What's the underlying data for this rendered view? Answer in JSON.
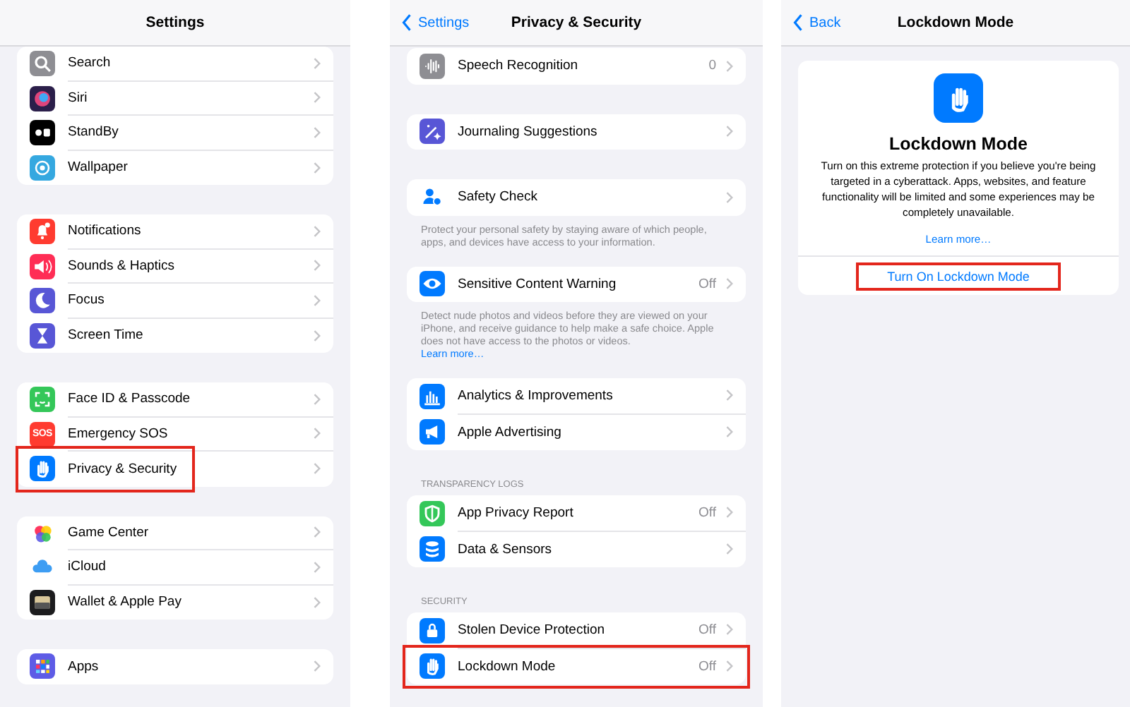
{
  "screens": [
    {
      "kind": "list",
      "title": "Settings",
      "groups": [
        {
          "items": [
            {
              "label": "Search",
              "color": "#8e8e93",
              "highlighted": false
            },
            {
              "label": "Siri",
              "color": "#2b1f4a",
              "highlighted": false
            },
            {
              "label": "StandBy",
              "color": "#000000",
              "highlighted": false
            },
            {
              "label": "Wallpaper",
              "color": "#35a8e0",
              "highlighted": false
            }
          ]
        },
        {
          "items": [
            {
              "label": "Notifications",
              "color": "#ff3b30",
              "highlighted": false
            },
            {
              "label": "Sounds & Haptics",
              "color": "#ff2d55",
              "highlighted": false
            },
            {
              "label": "Focus",
              "color": "#5856d6",
              "highlighted": false
            },
            {
              "label": "Screen Time",
              "color": "#5856d6",
              "highlighted": false
            }
          ]
        },
        {
          "items": [
            {
              "label": "Face ID & Passcode",
              "color": "#34c759",
              "highlighted": false
            },
            {
              "label": "Emergency SOS",
              "color": "#ff3b30",
              "icon_text": "SOS",
              "highlighted": false
            },
            {
              "label": "Privacy & Security",
              "color": "#007aff",
              "highlighted": true
            }
          ]
        },
        {
          "items": [
            {
              "label": "Game Center",
              "color": "#ffffff",
              "highlighted": false
            },
            {
              "label": "iCloud",
              "color": "#ffffff",
              "highlighted": false
            },
            {
              "label": "Wallet & Apple Pay",
              "color": "#1c1c1e",
              "highlighted": false
            }
          ]
        },
        {
          "items": [
            {
              "label": "Apps",
              "color": "#5e5ce6",
              "highlighted": false
            }
          ]
        }
      ]
    },
    {
      "kind": "list",
      "back": "Settings",
      "title": "Privacy & Security",
      "groups": [
        {
          "items": [
            {
              "label": "Speech Recognition",
              "value": "0",
              "color": "#8e8e93",
              "highlighted": false
            }
          ]
        },
        {
          "items": [
            {
              "label": "Journaling Suggestions",
              "color": "#5856d6",
              "highlighted": false
            }
          ]
        },
        {
          "items": [
            {
              "label": "Safety Check",
              "color": "#ffffff",
              "highlighted": false
            }
          ],
          "footer": "Protect your personal safety by staying aware of which people, apps, and devices have access to your information."
        },
        {
          "items": [
            {
              "label": "Sensitive Content Warning",
              "value": "Off",
              "color": "#007aff",
              "highlighted": false
            }
          ],
          "footer": "Detect nude photos and videos before they are viewed on your iPhone, and receive guidance to help make a safe choice. Apple does not have access to the photos or videos.",
          "footer_link": "Learn more…"
        },
        {
          "items": [
            {
              "label": "Analytics & Improvements",
              "color": "#007aff",
              "highlighted": false
            },
            {
              "label": "Apple Advertising",
              "color": "#007aff",
              "highlighted": false
            }
          ]
        },
        {
          "header": "TRANSPARENCY LOGS",
          "items": [
            {
              "label": "App Privacy Report",
              "value": "Off",
              "color": "#34c759",
              "highlighted": false
            },
            {
              "label": "Data & Sensors",
              "color": "#007aff",
              "highlighted": false
            }
          ]
        },
        {
          "header": "SECURITY",
          "items": [
            {
              "label": "Stolen Device Protection",
              "value": "Off",
              "color": "#007aff",
              "highlighted": false
            },
            {
              "label": "Lockdown Mode",
              "value": "Off",
              "color": "#007aff",
              "highlighted": true
            }
          ]
        }
      ]
    },
    {
      "kind": "detail",
      "back": "Back",
      "title": "Lockdown Mode",
      "heading": "Lockdown Mode",
      "description": "Turn on this extreme protection if you believe you're being targeted in a cyberattack. Apps, websites, and feature functionality will be limited and some experiences may be completely unavailable.",
      "link": "Learn more…",
      "action": {
        "label": "Turn On Lockdown Mode",
        "highlighted": true
      }
    }
  ]
}
